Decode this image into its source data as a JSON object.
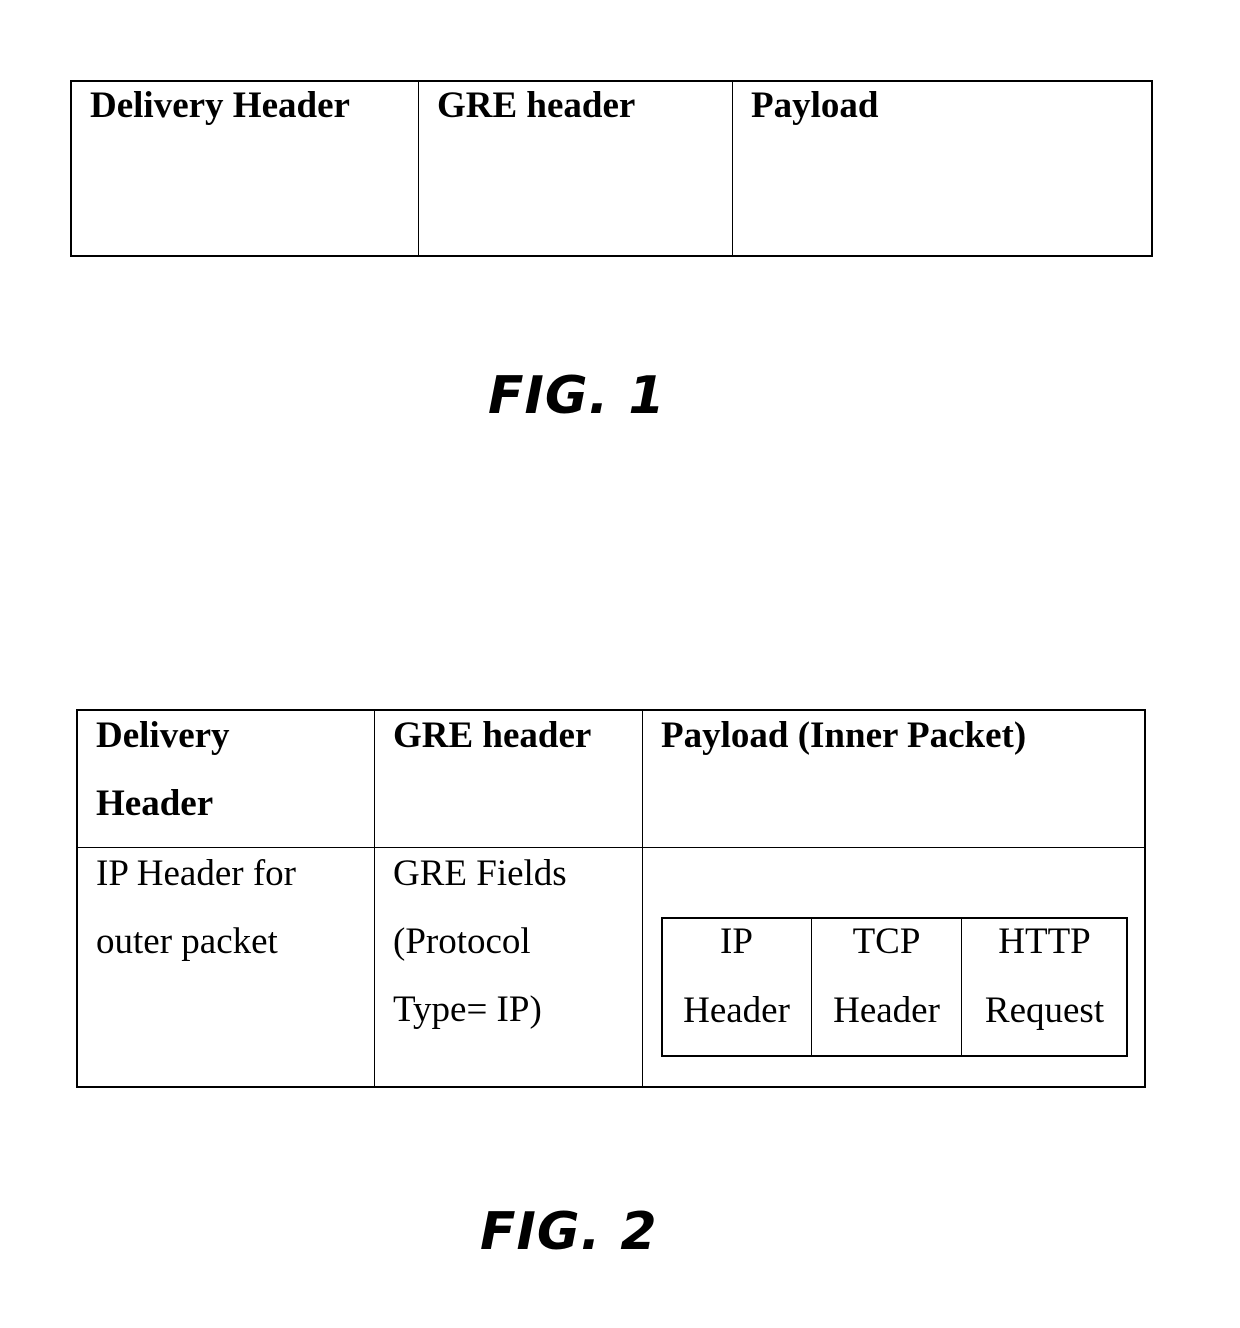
{
  "figure1": {
    "label": "FIG. 1",
    "columns": [
      "Delivery Header",
      "GRE header",
      "Payload"
    ]
  },
  "figure2": {
    "label": "FIG. 2",
    "header_row": [
      "Delivery",
      "Header",
      "GRE header",
      "Payload (Inner Packet)"
    ],
    "body_row": {
      "delivery": [
        "IP Header for",
        "outer packet"
      ],
      "gre": [
        "GRE Fields",
        "(Protocol",
        "Type= IP)"
      ]
    },
    "inner_packet": [
      {
        "line1": "IP",
        "line2": "Header"
      },
      {
        "line1": "TCP",
        "line2": "Header"
      },
      {
        "line1": "HTTP",
        "line2": "Request"
      }
    ]
  }
}
